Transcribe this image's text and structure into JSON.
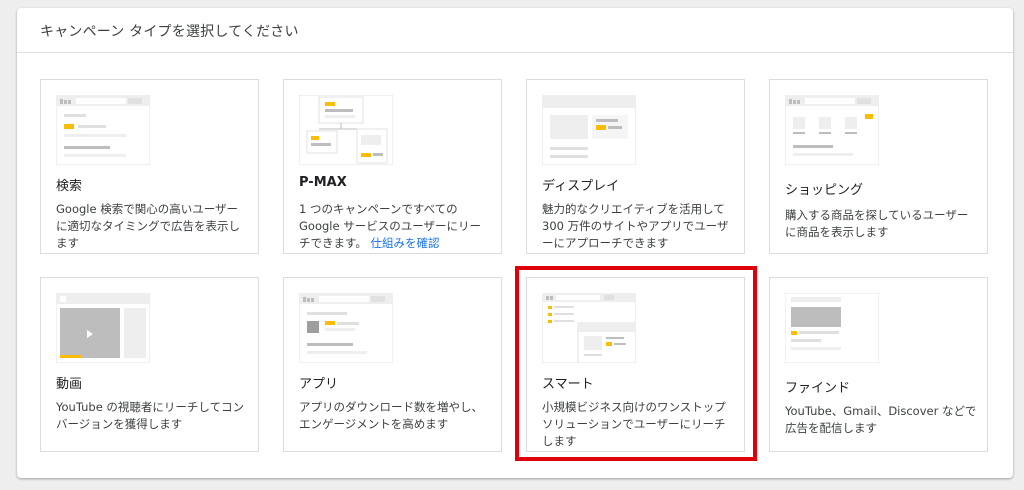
{
  "dialog": {
    "title": "キャンペーン タイプを選択してください"
  },
  "cards": [
    {
      "id": "search",
      "title": "検索",
      "description": "Google 検索で関心の高いユーザーに適切なタイミングで広告を表示します"
    },
    {
      "id": "pmax",
      "title": "P-MAX",
      "description": "1 つのキャンペーンですべての Google サービスのユーザーにリーチできます。",
      "link": "仕組みを確認"
    },
    {
      "id": "display",
      "title": "ディスプレイ",
      "description": "魅力的なクリエイティブを活用して 300 万件のサイトやアプリでユーザーにアプローチできます"
    },
    {
      "id": "shopping",
      "title": "ショッピング",
      "description": "購入する商品を探しているユーザーに商品を表示します"
    },
    {
      "id": "video",
      "title": "動画",
      "description": "YouTube の視聴者にリーチしてコンバージョンを獲得します"
    },
    {
      "id": "app",
      "title": "アプリ",
      "description": "アプリのダウンロード数を増やし、エンゲージメントを高めます"
    },
    {
      "id": "smart",
      "title": "スマート",
      "description": "小規模ビジネス向けのワンストップ ソリューションでユーザーにリーチします"
    },
    {
      "id": "discovery",
      "title": "ファインド",
      "description": "YouTube、Gmail、Discover などで広告を配信します"
    }
  ],
  "colors": {
    "accent": "#fbbc04",
    "highlight": "#e0000b",
    "link": "#1a73e8",
    "placeholder": "#e0e0e0"
  },
  "icons": {
    "search_icon": "🔍"
  }
}
